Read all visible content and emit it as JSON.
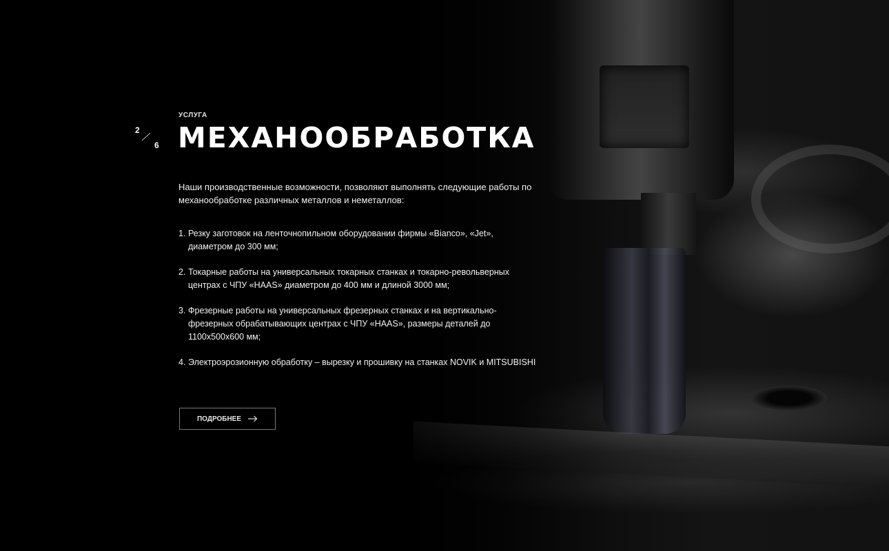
{
  "slider": {
    "current": "2",
    "total": "6"
  },
  "service": {
    "kicker": "УСЛУГА",
    "title": "МЕХАНООБРАБОТКА",
    "intro": "Наши производственные возможности, позволяют выполнять следующие работы по механообработке различных металлов и неметаллов:",
    "items": [
      {
        "num": "1.",
        "text": "Резку заготовок на ленточнопильном оборудовании фирмы «Bianco», «Jet», диаметром до 300 мм;"
      },
      {
        "num": "2.",
        "text": "Токарные работы на универсальных токарных станках и токарно-револьверных центрах с ЧПУ «HAAS» диаметром до 400 мм и длиной 3000 мм;"
      },
      {
        "num": "3.",
        "text": "Фрезерные работы на универсальных фрезерных станках и на вертикально-фрезерных обрабатывающих центрах с ЧПУ «HAAS», размеры деталей до 1100х500х600 мм;"
      },
      {
        "num": "4.",
        "text": "Электроэрозионную обработку – вырезку и прошивку на станках NOVIK  и MITSUBISHI"
      }
    ]
  },
  "cta": {
    "label": "ПОДРОБНЕЕ",
    "icon": "arrow-right-icon"
  }
}
